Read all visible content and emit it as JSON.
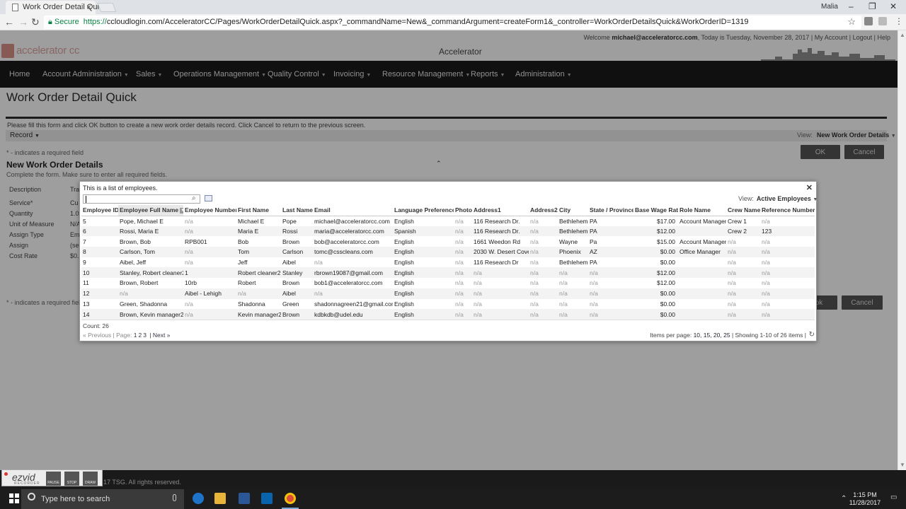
{
  "browser": {
    "tab_title": "Work Order Detail Quick",
    "user": "Malia",
    "secure_label": "Secure",
    "url_scheme": "https://",
    "url_rest": "ccloudlogin.com/AcceleratorCC/Pages/WorkOrderDetailQuick.aspx?_commandName=New&_commandArgument=createForm1&_controller=WorkOrderDetailsQuick&WorkOrderID=1319"
  },
  "header": {
    "welcome_prefix": "Welcome ",
    "welcome_user": "michael@acceleratorcc.com",
    "welcome_rest": ", Today is Tuesday, November 28, 2017 | My Account | Logout | Help",
    "logo_text": "accelerator cc",
    "app_title": "Accelerator"
  },
  "nav": [
    {
      "label": "Home",
      "caret": false
    },
    {
      "label": "Account Administration",
      "caret": true
    },
    {
      "label": "Sales",
      "caret": true
    },
    {
      "label": "Operations Management",
      "caret": true
    },
    {
      "label": "Quality Control",
      "caret": true
    },
    {
      "label": "Invoicing",
      "caret": true
    },
    {
      "label": "Resource Management",
      "caret": true
    },
    {
      "label": "Reports",
      "caret": true
    },
    {
      "label": "Administration",
      "caret": true
    }
  ],
  "page": {
    "title": "Work Order Detail Quick",
    "info": "Please fill this form and click OK button to create a new work order details record. Click Cancel to return to the previous screen.",
    "record_label": "Record",
    "view_label": "View:",
    "view_value": "New Work Order Details",
    "required_note": "* - indicates a required field",
    "ok_label": "OK",
    "cancel_label": "Cancel",
    "section_title": "New Work Order Details",
    "section_sub": "Complete the form. Make sure to enter all required fields.",
    "form_labels": [
      "Description",
      "Service*",
      "Quantity",
      "Unit of Measure",
      "Assign Type",
      "Assign",
      "Cost Rate"
    ],
    "form_values": [
      "Tra",
      "Cu",
      "1.0",
      "N/A",
      "Em",
      "(se",
      "$0."
    ]
  },
  "dialog": {
    "title": "This is a list of employees.",
    "search_value": "",
    "view_label": "View:",
    "view_value": "Active Employees",
    "columns": [
      "Employee ID",
      "Employee Full Name",
      "Employee Number",
      "First Name",
      "Last Name",
      "Email",
      "Language Preference",
      "Photo",
      "Address1",
      "Address2",
      "City",
      "State / Province",
      "Base Wage Rate",
      "Role Name",
      "Crew Name",
      "Reference Number"
    ],
    "rows": [
      [
        "5",
        "Pope, Michael E",
        "n/a",
        "Michael E",
        "Pope",
        "michael@acceleratorcc.com",
        "English",
        "n/a",
        "116 Research Dr.",
        "n/a",
        "Bethlehem",
        "PA",
        "$17.00",
        "Account Manager",
        "Crew 1",
        "n/a"
      ],
      [
        "6",
        "Rossi, Maria E",
        "n/a",
        "Maria E",
        "Rossi",
        "maria@acceleratorcc.com",
        "Spanish",
        "n/a",
        "116 Research Dr.",
        "n/a",
        "Bethlehem",
        "PA",
        "$12.00",
        "",
        "Crew 2",
        "123"
      ],
      [
        "7",
        "Brown, Bob",
        "RPB001",
        "Bob",
        "Brown",
        "bob@acceleratorcc.com",
        "English",
        "n/a",
        "1661 Weedon Rd",
        "n/a",
        "Wayne",
        "Pa",
        "$15.00",
        "Account Manager",
        "n/a",
        "n/a"
      ],
      [
        "8",
        "Carlson, Tom",
        "n/a",
        "Tom",
        "Carlson",
        "tomc@csscleans.com",
        "English",
        "n/a",
        "2030 W. Desert Cove",
        "n/a",
        "Phoenix",
        "AZ",
        "$0.00",
        "Office Manager",
        "n/a",
        "n/a"
      ],
      [
        "9",
        "Aibel, Jeff",
        "n/a",
        "Jeff",
        "Aibel",
        "n/a",
        "English",
        "n/a",
        "116 Research Dr",
        "n/a",
        "Bethlehem",
        "PA",
        "$0.00",
        "",
        "n/a",
        "n/a"
      ],
      [
        "10",
        "Stanley, Robert cleaner2",
        "1",
        "Robert cleaner2",
        "Stanley",
        "rbrown19087@gmail.com",
        "English",
        "n/a",
        "n/a",
        "n/a",
        "n/a",
        "n/a",
        "$12.00",
        "",
        "n/a",
        "n/a"
      ],
      [
        "11",
        "Brown, Robert",
        "10rb",
        "Robert",
        "Brown",
        "bob1@acceleratorcc.com",
        "English",
        "n/a",
        "n/a",
        "n/a",
        "n/a",
        "n/a",
        "$12.00",
        "",
        "n/a",
        "n/a"
      ],
      [
        "12",
        "n/a",
        "Aibel - Lehigh",
        "n/a",
        "Aibel",
        "n/a",
        "English",
        "n/a",
        "n/a",
        "n/a",
        "n/a",
        "n/a",
        "$0.00",
        "",
        "n/a",
        "n/a"
      ],
      [
        "13",
        "Green, Shadonna",
        "n/a",
        "Shadonna",
        "Green",
        "shadonnagreen21@gmail.com",
        "English",
        "n/a",
        "n/a",
        "n/a",
        "n/a",
        "n/a",
        "$0.00",
        "",
        "n/a",
        "n/a"
      ],
      [
        "14",
        "Brown, Kevin manager2",
        "n/a",
        "Kevin manager2",
        "Brown",
        "kdbkdb@udel.edu",
        "English",
        "n/a",
        "n/a",
        "n/a",
        "n/a",
        "n/a",
        "$0.00",
        "",
        "n/a",
        "n/a"
      ]
    ],
    "count": "Count: 26",
    "prev": "« Previous",
    "page_label": "| Page:",
    "pages": [
      "1",
      "2",
      "3"
    ],
    "next": "| Next »",
    "items_per_page_label": "Items per page:",
    "items_per_page_options": "10, 15, 20, 25",
    "showing": "| Showing 1-10 of 26 items |"
  },
  "footer": {
    "copyright": "17 TSG. All rights reserved."
  },
  "recorder": {
    "brand": "ezvid",
    "sub": "RECORDER",
    "buttons": [
      "PAUSE",
      "STOP",
      "DRAW"
    ]
  },
  "taskbar": {
    "search_placeholder": "Type here to search",
    "time": "1:15 PM",
    "date": "11/28/2017"
  },
  "colors": {
    "nav_bg": "#1a1a1a",
    "secure_green": "#0b8043",
    "brand_red": "#b03a2e"
  }
}
